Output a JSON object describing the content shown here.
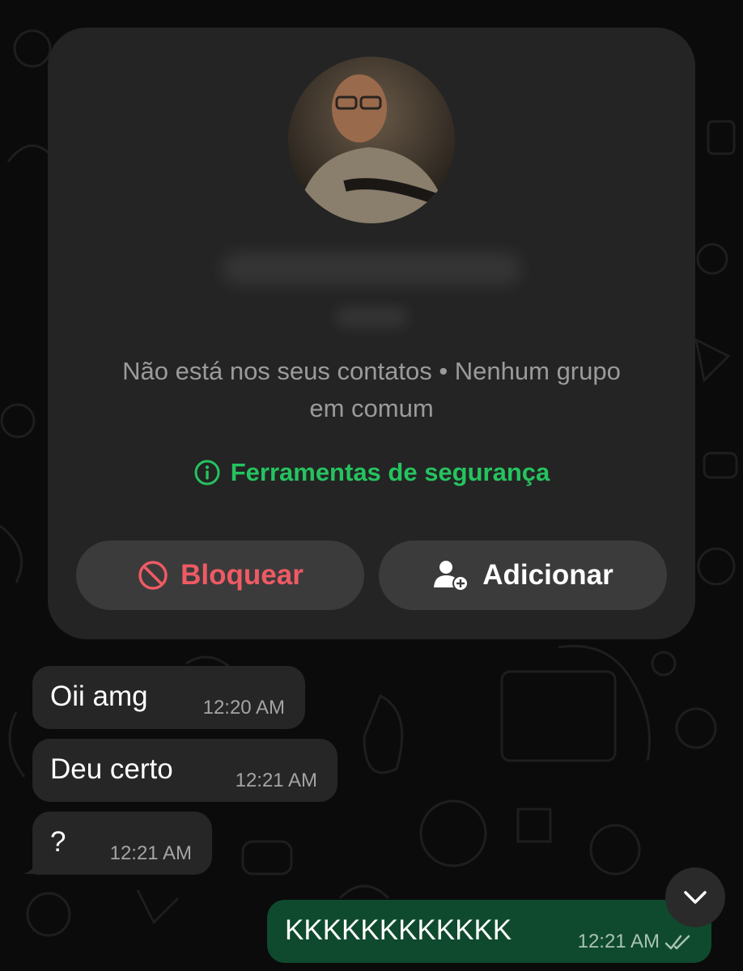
{
  "contact_card": {
    "info_line1": "Não está nos seus contatos • Nenhum grupo",
    "info_line2": "em comum",
    "safety_tools_label": "Ferramentas de segurança",
    "block_label": "Bloquear",
    "add_label": "Adicionar",
    "icons": {
      "safety": "info-circle-icon",
      "block": "block-icon",
      "add": "add-contact-icon"
    }
  },
  "messages": [
    {
      "direction": "incoming",
      "text": "Oii amg",
      "time": "12:20 AM"
    },
    {
      "direction": "incoming",
      "text": "Deu certo",
      "time": "12:21 AM"
    },
    {
      "direction": "incoming",
      "text": "?",
      "time": "12:21 AM"
    },
    {
      "direction": "outgoing",
      "text": "KKKKKKKKKKKK",
      "time": "12:21 AM",
      "status": "read"
    }
  ],
  "colors": {
    "background": "#0b0b0b",
    "card": "#242424",
    "accent_green": "#25c35f",
    "danger_red": "#ef5a64",
    "incoming_bubble": "#262626",
    "outgoing_bubble": "#0f4a2e"
  }
}
